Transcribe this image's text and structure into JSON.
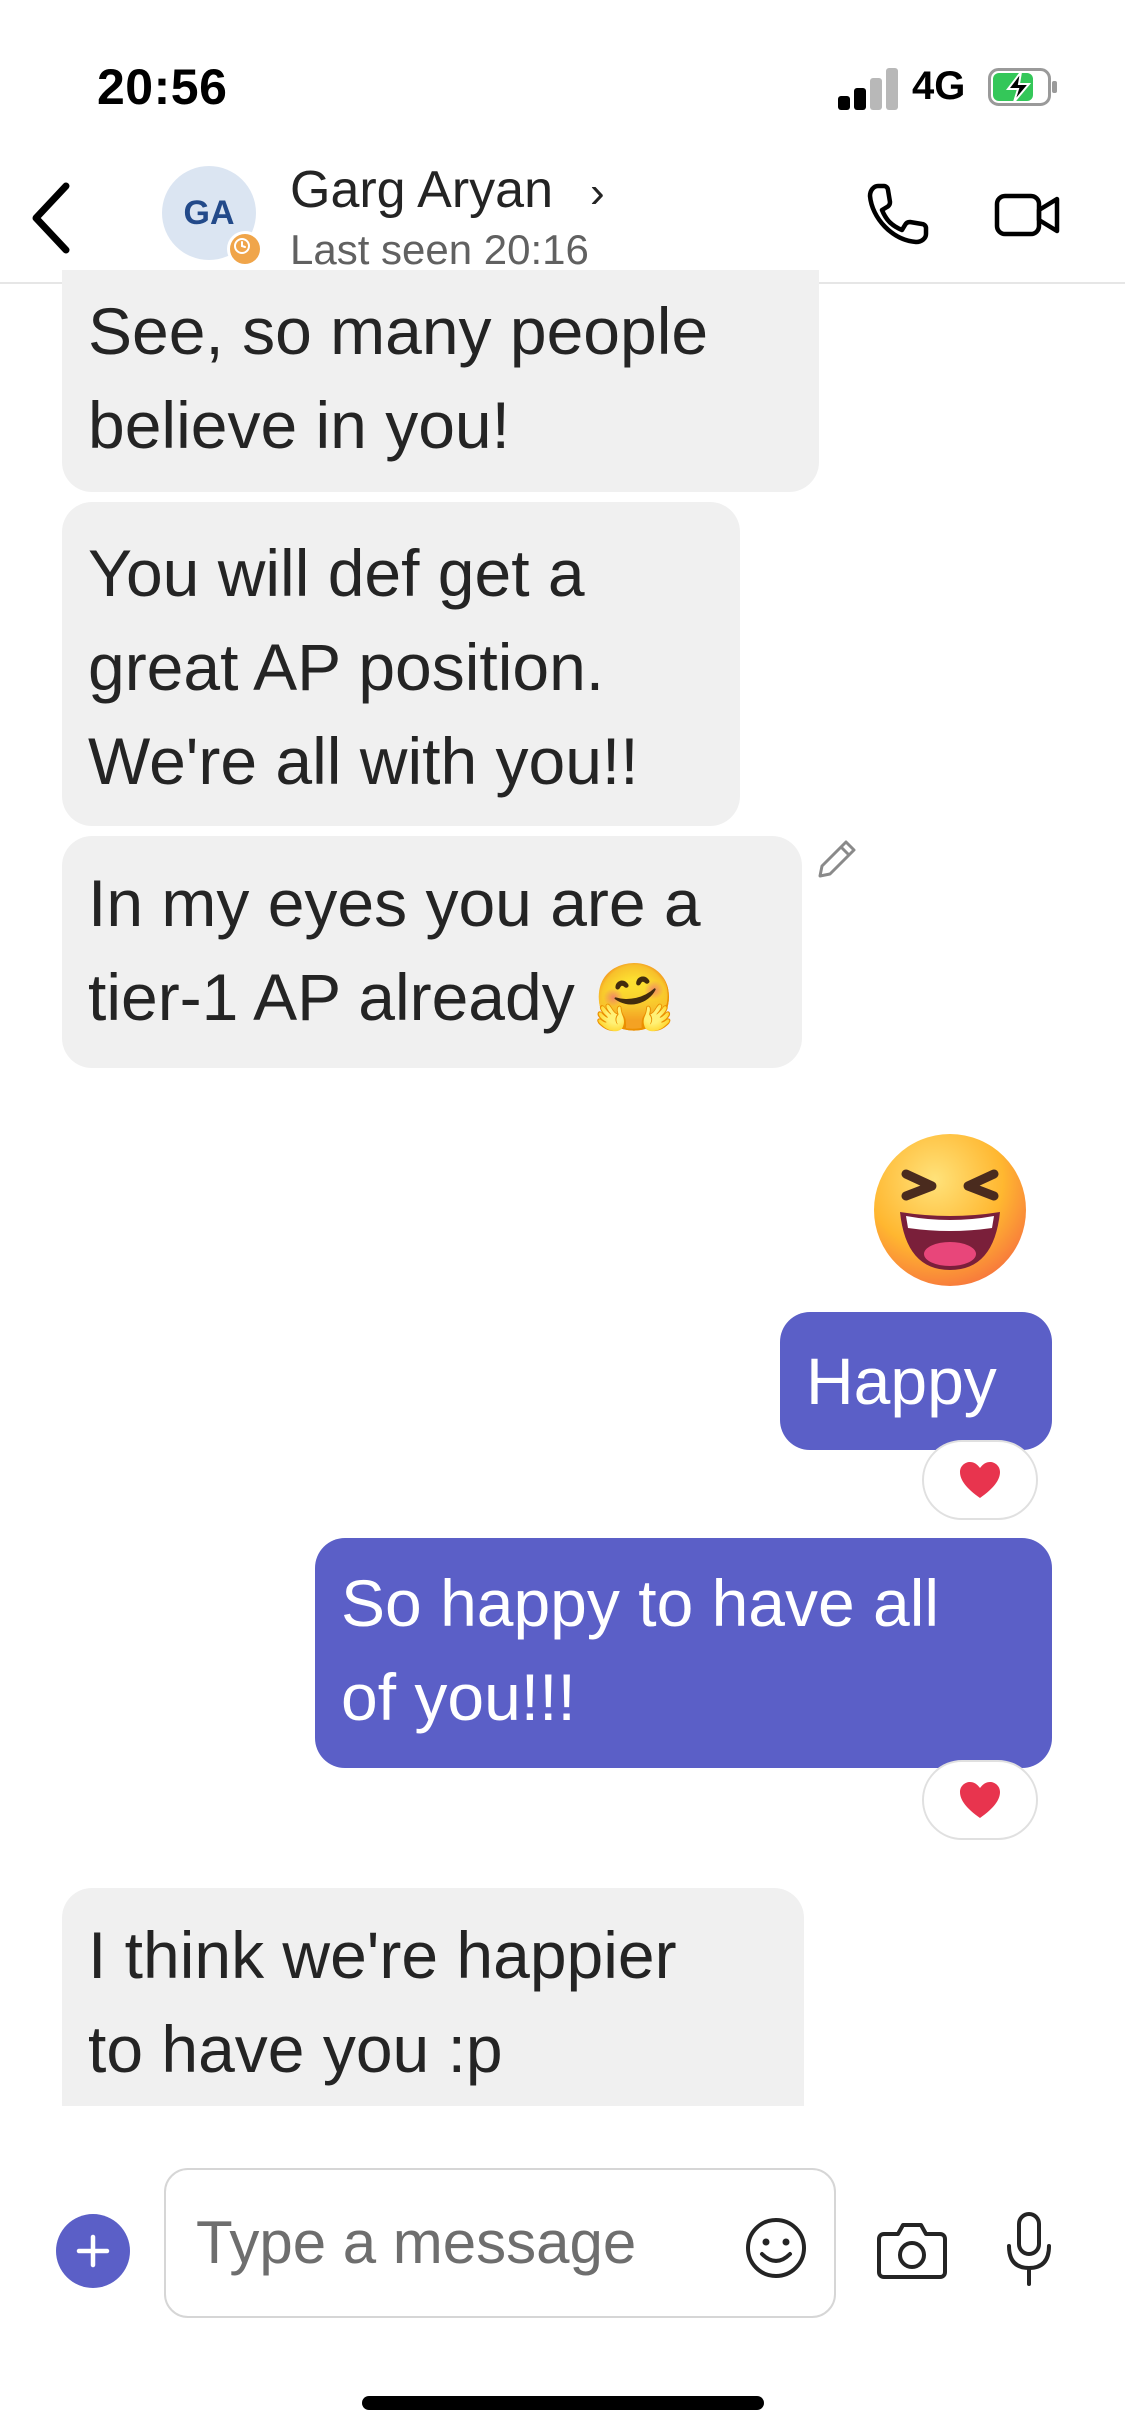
{
  "status_bar": {
    "time": "20:56",
    "network": "4G"
  },
  "header": {
    "avatar_initials": "GA",
    "contact_name": "Garg Aryan",
    "chevron": "›",
    "last_seen": "Last seen 20:16"
  },
  "messages": [
    {
      "direction": "incoming",
      "lines": [
        "See, so many people",
        "believe in you!"
      ]
    },
    {
      "direction": "incoming",
      "lines": [
        "You will def get a",
        "great AP position.",
        "We're all with you!!"
      ]
    },
    {
      "direction": "incoming",
      "lines": [
        "In my eyes you are a",
        "tier-1 AP already 🤗"
      ],
      "edited": true
    },
    {
      "direction": "outgoing",
      "type": "sticker",
      "icon": "grinning-squinting-face-sticker"
    },
    {
      "direction": "outgoing",
      "lines": [
        "Happy"
      ],
      "reaction": "heart"
    },
    {
      "direction": "outgoing",
      "lines": [
        "So happy to have all",
        "of you!!!"
      ],
      "reaction": "heart"
    },
    {
      "direction": "incoming",
      "lines": [
        "I think we're happier",
        "to have you :p"
      ]
    }
  ],
  "composer": {
    "placeholder": "Type a message"
  },
  "colors": {
    "brand": "#5b5fc7",
    "incoming_bubble": "#f0f0f0",
    "presence_away": "#f0a54a",
    "reaction_heart": "#e8344e"
  }
}
